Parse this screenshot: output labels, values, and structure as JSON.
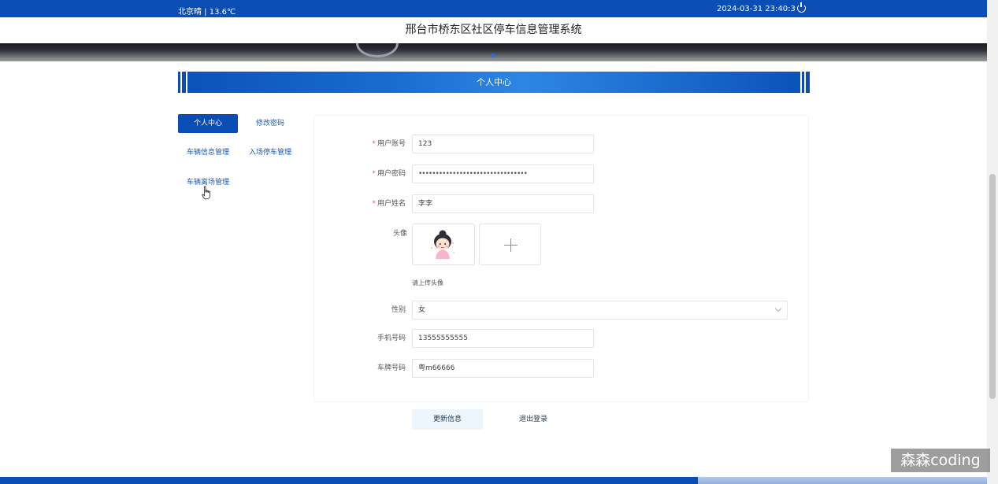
{
  "topbar": {
    "weather": "北京晴 | 13.6℃",
    "datetime": "2024-03-31  23:40:3"
  },
  "site_title": "邢台市桥东区社区停车信息管理系统",
  "section_title": "个人中心",
  "menu": {
    "items": [
      {
        "label": "个人中心",
        "active": true
      },
      {
        "label": "修改密码",
        "active": false
      },
      {
        "label": "车辆信息管理",
        "active": false
      },
      {
        "label": "入场停车管理",
        "active": false
      },
      {
        "label": "车辆离场管理",
        "active": false
      }
    ]
  },
  "form": {
    "account": {
      "label": "用户账号",
      "required": true,
      "value": "123"
    },
    "password": {
      "label": "用户密码",
      "required": true,
      "value": "••••••••••••••••••••••••••••••••"
    },
    "name": {
      "label": "用户姓名",
      "required": true,
      "value": "李李"
    },
    "avatar": {
      "label": "头像",
      "hint": "请上传头像"
    },
    "gender": {
      "label": "性别",
      "value": "女"
    },
    "phone": {
      "label": "手机号码",
      "value": "13555555555"
    },
    "plate": {
      "label": "车牌号码",
      "value": "粤m66666"
    }
  },
  "buttons": {
    "update": "更新信息",
    "logout": "退出登录"
  },
  "watermark": "森森coding",
  "colors": {
    "primary": "#0a4db5",
    "required": "#e25c5c",
    "update_bg": "#edf6fd"
  }
}
